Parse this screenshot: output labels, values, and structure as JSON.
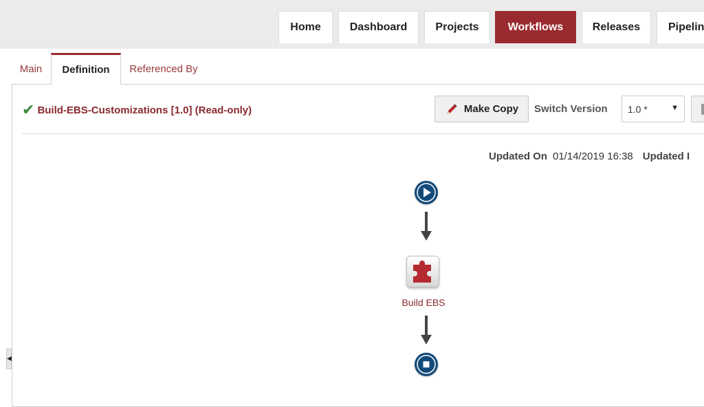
{
  "nav": {
    "items": [
      {
        "label": "Home",
        "active": false
      },
      {
        "label": "Dashboard",
        "active": false
      },
      {
        "label": "Projects",
        "active": false
      },
      {
        "label": "Workflows",
        "active": true
      },
      {
        "label": "Releases",
        "active": false
      },
      {
        "label": "Pipelin",
        "active": false
      }
    ]
  },
  "tabs": [
    {
      "label": "Main",
      "active": false
    },
    {
      "label": "Definition",
      "active": true
    },
    {
      "label": "Referenced By",
      "active": false
    }
  ],
  "workflow": {
    "title": "Build-EBS-Customizations [1.0] (Read-only)",
    "make_copy_label": "Make Copy",
    "switch_version_label": "Switch Version",
    "version_selected": "1.0 *",
    "updated_on_label": "Updated On",
    "updated_on_value": "01/14/2019 16:38",
    "updated_by_label": "Updated I"
  },
  "flow": {
    "step_label": "Build EBS"
  },
  "colors": {
    "brand": "#9a2a2f",
    "node_blue": "#124a7a",
    "success": "#3c8a3c"
  },
  "icons": {
    "status": "check-icon",
    "copy": "pencil-icon",
    "start": "play-icon",
    "end": "stop-icon",
    "step": "puzzle-piece-icon"
  }
}
